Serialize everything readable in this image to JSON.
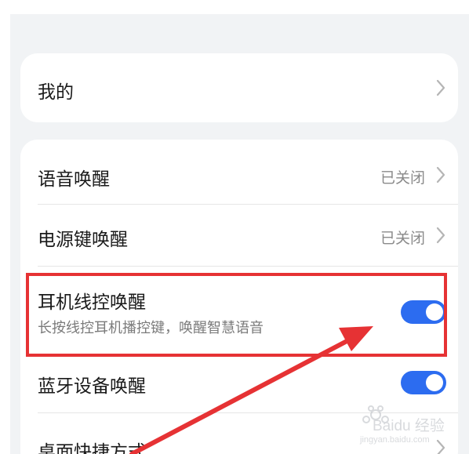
{
  "mine_section": {
    "label": "我的"
  },
  "wake_section": {
    "items": [
      {
        "label": "语音唤醒",
        "value": "已关闭"
      },
      {
        "label": "电源键唤醒",
        "value": "已关闭"
      },
      {
        "label": "耳机线控唤醒",
        "subtitle": "长按线控耳机播控键，唤醒智慧语音",
        "toggle": "on"
      },
      {
        "label": "蓝牙设备唤醒",
        "toggle": "on"
      },
      {
        "label": "桌面快捷方式"
      }
    ]
  },
  "colors": {
    "accent": "#2c6cf0",
    "highlight": "#e63234",
    "background": "#f1f3f5"
  },
  "icons": {
    "chevron": "chevron-right-icon",
    "watermark": "baidu-jingyan-logo"
  },
  "watermark": {
    "text": "Baidu 经验",
    "url": "jingyan.baidu.com"
  }
}
